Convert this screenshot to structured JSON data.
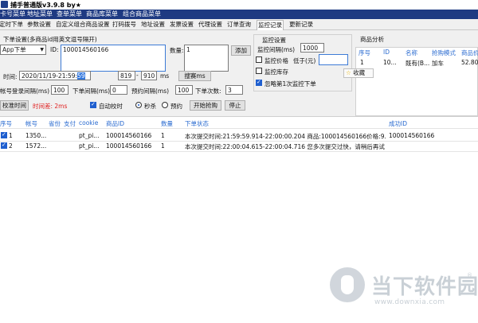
{
  "window": {
    "title": "捕手普通版v3.9.8    by★"
  },
  "menubar": {
    "items": [
      "卡号菜单",
      "地址菜单",
      "查单菜单",
      "商品库菜单",
      "组合商品菜单"
    ]
  },
  "tabs": {
    "items": [
      "定时下单",
      "参数设置",
      "自定义组合商品设置",
      "打码拨号",
      "地址设置",
      "发票设置",
      "代理设置",
      "订单查询",
      "监控记录",
      "更新记录"
    ],
    "active": "监控记录"
  },
  "order": {
    "group_title": "下单设置(多商品id用英文逗号隔开)",
    "mode_select": "App下单",
    "id_label": "ID:",
    "id_value": "100014560166",
    "qty_label": "数量:",
    "qty_value": "1",
    "add_button": "添加",
    "time_label": "时间:",
    "time_prefix": "2020/11/19-21:59:",
    "time_selected": "59",
    "time_ms_from": "819",
    "time_ms_to": "910",
    "ms_label": "ms",
    "sync_button": "搜赛ms",
    "login_interval_label": "帐号登录间隔(ms)",
    "login_interval_value": "100",
    "order_interval_label": "下单间隔(ms)",
    "order_interval_value": "0",
    "reserve_interval_label": "预约间隔(ms)",
    "reserve_interval_value": "100",
    "order_count_label": "下单次数:",
    "order_count_value": "3",
    "calibrate_button": "校准时间",
    "time_diff_label": "时间差: 2ms",
    "auto_calibrate_label": "自动校时",
    "auto_calibrate_checked": true,
    "radio_seckill_label": "秒杀",
    "radio_reserve_label": "预约",
    "start_button": "开始抢购",
    "stop_button": "停止"
  },
  "monitor": {
    "group_title": "监控设置",
    "interval_label": "监控间隔(ms)",
    "interval_value": "1000",
    "price_label": "监控价格",
    "below_label": "低于(元)",
    "below_value": "",
    "stock_label": "监控库存",
    "ignore_first_label": "忽略第1次监控下单",
    "ignore_first_checked": true
  },
  "tooltip": {
    "icon": "star-icon",
    "text": "收藏"
  },
  "analysis": {
    "group_title": "商品分析",
    "headers": [
      "序号",
      "ID",
      "名称",
      "抢购模式",
      "商品价"
    ],
    "rows": [
      [
        "1",
        "10...",
        "既有(B...",
        "加车",
        "52.80"
      ]
    ]
  },
  "grid": {
    "headers": [
      "序号",
      "帐号",
      "省份",
      "支付",
      "cookie",
      "商品ID",
      "数量",
      "下单状态",
      "成功ID"
    ],
    "rows": [
      {
        "index": "1",
        "account": "1350...",
        "cookie": "pt_pi...",
        "product_id": "100014560166",
        "qty": "1",
        "status": "本次提交时间:21:59:59.914-22:00:00.204 商品:100014560166价格:9...",
        "success_id": "100014560166",
        "checked": true
      },
      {
        "index": "2",
        "account": "1572...",
        "cookie": "pt_pi...",
        "product_id": "100014560166",
        "qty": "1",
        "status": "本次提交时间:22:00:04.615-22:00:04.716 您多次提交过快，请稍后再试",
        "success_id": "",
        "checked": true
      }
    ]
  },
  "watermark": {
    "name": "当下软件园",
    "url": "www.downxia.com",
    "reg": "®"
  },
  "colors": {
    "menubar": "#1e3a82",
    "header_text": "#2a6bd0",
    "error": "#e02020",
    "selection": "#3377dd"
  }
}
